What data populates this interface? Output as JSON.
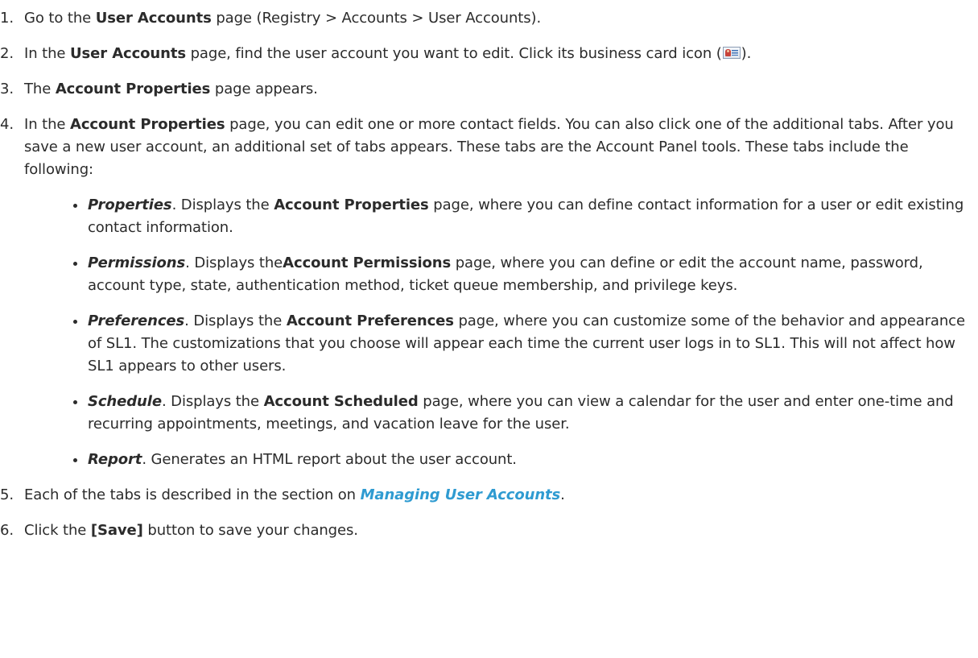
{
  "steps": [
    {
      "num": "1.",
      "t1": "Go to the ",
      "b1": "User Accounts",
      "t2": " page (Registry > Accounts > User Accounts)."
    },
    {
      "num": "2.",
      "t1": "In the ",
      "b1": "User Accounts",
      "t2": " page, find the user account you want to edit. Click its business card icon (",
      "t3": ")."
    },
    {
      "num": "3.",
      "t1": "The ",
      "b1": "Account Properties",
      "t2": " page appears."
    },
    {
      "num": "4.",
      "t1": "In the ",
      "b1": "Account Properties",
      "t2": " page, you can edit one or more contact fields. You can also click one of the additional tabs. After you save a new user account, an additional set of tabs appears. These tabs are the Account Panel tools. These tabs include the following:"
    },
    {
      "num": "5.",
      "t1": "Each of the tabs is described in the section on ",
      "link": "Managing User Accounts",
      "t2": "."
    },
    {
      "num": "6.",
      "t1": "Click the ",
      "b1": "[Save]",
      "t2": " button to save your changes."
    }
  ],
  "tabs": [
    {
      "name": "Properties",
      "t1": ". Displays the ",
      "b1": "Account Properties",
      "t2": " page, where you can define contact information for a user or edit existing contact information."
    },
    {
      "name": "Permissions",
      "t1": ". Displays the",
      "b1": "Account Permissions",
      "t2": " page, where you can define or edit the account name, password, account type, state, authentication method, ticket queue membership, and privilege keys."
    },
    {
      "name": "Preferences",
      "t1": ". Displays the ",
      "b1": "Account Preferences",
      "t2": " page, where you can customize some of the behavior and appearance of SL1. The customizations that you choose will appear each time the current user logs in to SL1. This will not affect how SL1 appears to other users."
    },
    {
      "name": "Schedule",
      "t1": ". Displays the ",
      "b1": "Account Scheduled",
      "t2": " page, where you can view a calendar for the user and enter one-time and recurring appointments, meetings, and vacation leave for the user."
    },
    {
      "name": "Report",
      "t1": ". Generates an HTML report about the user account."
    }
  ],
  "icons": {
    "business_card": "business-card-icon"
  },
  "colors": {
    "text": "#2b2b2b",
    "link": "#2f9bd1"
  }
}
